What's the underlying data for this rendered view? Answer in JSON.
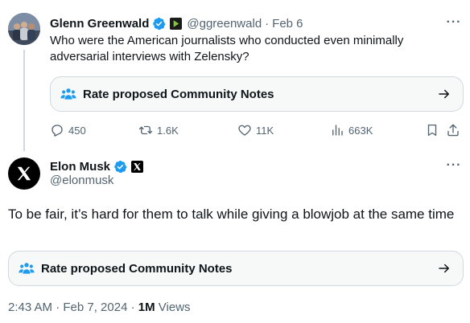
{
  "parent_tweet": {
    "author_name": "Glenn Greenwald",
    "handle": "@ggreenwald",
    "separator": "·",
    "date": "Feb 6",
    "text": "Who were the American journalists who conducted even minimally adversarial interviews with Zelensky?",
    "community_notes_label": "Rate proposed Community Notes",
    "metrics": {
      "replies": "450",
      "reposts": "1.6K",
      "likes": "11K",
      "views": "663K"
    }
  },
  "main_tweet": {
    "author_name": "Elon Musk",
    "handle": "@elonmusk",
    "text": "To be fair, it’s hard for them to talk while giving a blowjob at the same time",
    "community_notes_label": "Rate proposed Community Notes",
    "timestamp": "2:43 AM · Feb 7, 2024",
    "meta_separator": "·",
    "views_count": "1M",
    "views_label": "Views"
  },
  "icons": {
    "more": "more-horizontal-icon",
    "verified": "verified-badge-icon",
    "rumble": "rumble-badge-icon",
    "x_affiliate": "x-logo-badge-icon",
    "community_notes": "community-notes-people-icon",
    "arrow": "arrow-right-icon",
    "reply": "reply-icon",
    "repost": "repost-icon",
    "like": "like-icon",
    "views": "views-chart-icon",
    "bookmark": "bookmark-icon",
    "share": "share-icon"
  },
  "colors": {
    "verified_blue": "#1d9bf0",
    "text_primary": "#0f1419",
    "text_secondary": "#536471",
    "border": "#cfd9de",
    "card_bg": "#f7f9f9",
    "rumble_green": "#85c742"
  },
  "more_glyph": "···"
}
